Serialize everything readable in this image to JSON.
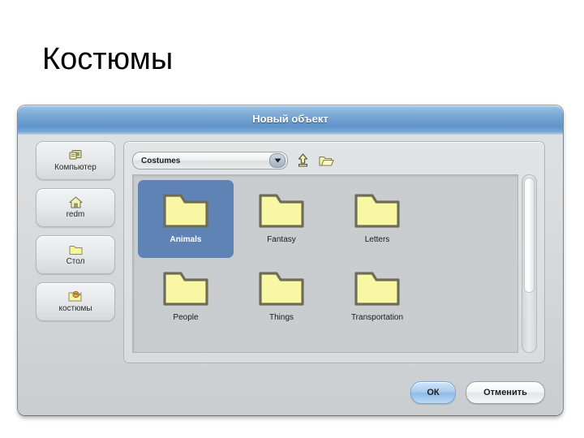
{
  "slide": {
    "title": "Костюмы"
  },
  "dialog": {
    "title": "Новый объект",
    "sidebar": {
      "items": [
        {
          "label": "Компьютер",
          "icon": "computer-icon"
        },
        {
          "label": "redm",
          "icon": "home-icon"
        },
        {
          "label": "Стол",
          "icon": "folder-icon"
        },
        {
          "label": "костюмы",
          "icon": "folder-image-icon"
        }
      ]
    },
    "toolbar": {
      "location_value": "Costumes",
      "dropdown_icon": "chevron-down-icon",
      "up_button_icon": "go-up-icon",
      "new_folder_button_icon": "new-folder-icon"
    },
    "files": [
      {
        "label": "Animals",
        "selected": true
      },
      {
        "label": "Fantasy",
        "selected": false
      },
      {
        "label": "Letters",
        "selected": false
      },
      {
        "label": "People",
        "selected": false
      },
      {
        "label": "Things",
        "selected": false
      },
      {
        "label": "Transportation",
        "selected": false
      }
    ],
    "scrollbar": {
      "orientation": "vertical",
      "thumb_position": "top"
    },
    "buttons": {
      "ok": "ОК",
      "cancel": "Отменить"
    }
  },
  "colors": {
    "titlebar_blue": "#6f9fd0",
    "selection_blue": "#5f83b4",
    "folder_yellow": "#f7f5a0",
    "folder_outline": "#6e6e58",
    "dialog_gray": "#d7dadc",
    "ok_button_blue": "#a9cdee"
  }
}
